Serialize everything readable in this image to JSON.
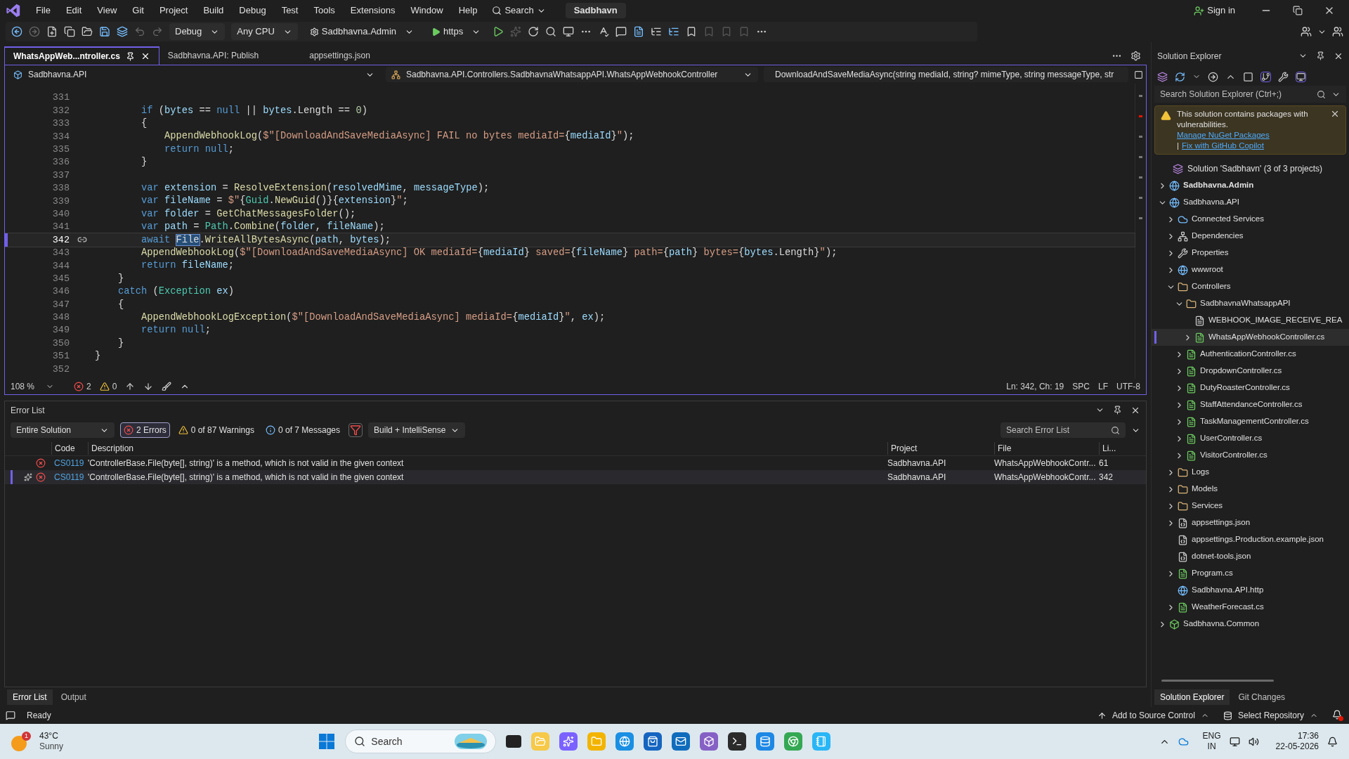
{
  "menu_bar": {
    "items": [
      "File",
      "Edit",
      "View",
      "Git",
      "Project",
      "Build",
      "Debug",
      "Test",
      "Tools",
      "Extensions",
      "Window",
      "Help"
    ],
    "search": "Search",
    "solution": "Sadbhavn",
    "sign_in": "Sign in"
  },
  "toolbar": {
    "dropdowns": [
      {
        "kind": "config",
        "label": "Debug"
      },
      {
        "kind": "platform",
        "label": "Any CPU"
      },
      {
        "kind": "startup",
        "label": "Sadbhavna.Admin"
      },
      {
        "kind": "run",
        "label": "https"
      }
    ]
  },
  "document_tabs": [
    {
      "label": "WhatsAppWeb...ntroller.cs",
      "selected": true
    },
    {
      "label": "Sadbhavna.API: Publish",
      "selected": false
    },
    {
      "label": "appsettings.json",
      "selected": false
    }
  ],
  "nav_bar": {
    "project": "Sadbhavna.API",
    "class": "Sadbhavna.API.Controllers.SadbhavnaWhatsappAPI.WhatsAppWebhookController",
    "member": "DownloadAndSaveMediaAsync(string mediaId, string? mimeType, string messageType, str"
  },
  "editor": {
    "lines": [
      {
        "number": "331",
        "current": false
      },
      {
        "number": "332",
        "current": false,
        "tokens": [
          {
            "kind": "kw",
            "text": "        if"
          },
          {
            "kind": "txt",
            "text": " ("
          },
          {
            "kind": "var",
            "text": "bytes"
          },
          {
            "kind": "txt",
            "text": " == "
          },
          {
            "kind": "kw",
            "text": "null"
          },
          {
            "kind": "txt",
            "text": " || "
          },
          {
            "kind": "var",
            "text": "bytes"
          },
          {
            "kind": "txt",
            "text": ".Length == "
          },
          {
            "kind": "num",
            "text": "0"
          },
          {
            "kind": "txt",
            "text": ")"
          }
        ]
      },
      {
        "number": "333",
        "current": false,
        "tokens": [
          {
            "kind": "txt",
            "text": "        {"
          }
        ]
      },
      {
        "number": "334",
        "current": false,
        "tokens": [
          {
            "kind": "fn",
            "text": "            AppendWebhookLog"
          },
          {
            "kind": "txt",
            "text": "("
          },
          {
            "kind": "str",
            "text": "$\"[DownloadAndSaveMediaAsync] FAIL no bytes mediaId="
          },
          {
            "kind": "txt",
            "text": "{"
          },
          {
            "kind": "var",
            "text": "mediaId"
          },
          {
            "kind": "txt",
            "text": "}"
          },
          {
            "kind": "str",
            "text": "\""
          },
          {
            "kind": "txt",
            "text": ");"
          }
        ]
      },
      {
        "number": "335",
        "current": false,
        "tokens": [
          {
            "kind": "kw",
            "text": "            return null"
          },
          {
            "kind": "txt",
            "text": ";"
          }
        ]
      },
      {
        "number": "336",
        "current": false,
        "tokens": [
          {
            "kind": "txt",
            "text": "        }"
          }
        ]
      },
      {
        "number": "337",
        "current": false
      },
      {
        "number": "338",
        "current": false,
        "tokens": [
          {
            "kind": "kw",
            "text": "        var "
          },
          {
            "kind": "var",
            "text": "extension"
          },
          {
            "kind": "txt",
            "text": " = "
          },
          {
            "kind": "fn",
            "text": "ResolveExtension"
          },
          {
            "kind": "txt",
            "text": "("
          },
          {
            "kind": "var",
            "text": "resolvedMime"
          },
          {
            "kind": "txt",
            "text": ", "
          },
          {
            "kind": "var",
            "text": "messageType"
          },
          {
            "kind": "txt",
            "text": ");"
          }
        ]
      },
      {
        "number": "339",
        "current": false,
        "tokens": [
          {
            "kind": "kw",
            "text": "        var "
          },
          {
            "kind": "var",
            "text": "fileName"
          },
          {
            "kind": "txt",
            "text": " = "
          },
          {
            "kind": "str",
            "text": "$\""
          },
          {
            "kind": "txt",
            "text": "{"
          },
          {
            "kind": "ty",
            "text": "Guid"
          },
          {
            "kind": "txt",
            "text": "."
          },
          {
            "kind": "fn",
            "text": "NewGuid"
          },
          {
            "kind": "txt",
            "text": "()}{"
          },
          {
            "kind": "var",
            "text": "extension"
          },
          {
            "kind": "txt",
            "text": "}"
          },
          {
            "kind": "str",
            "text": "\""
          },
          {
            "kind": "txt",
            "text": ";"
          }
        ]
      },
      {
        "number": "340",
        "current": false,
        "tokens": [
          {
            "kind": "kw",
            "text": "        var "
          },
          {
            "kind": "var",
            "text": "folder"
          },
          {
            "kind": "txt",
            "text": " = "
          },
          {
            "kind": "fn",
            "text": "GetChatMessagesFolder"
          },
          {
            "kind": "txt",
            "text": "();"
          }
        ]
      },
      {
        "number": "341",
        "current": false,
        "tokens": [
          {
            "kind": "kw",
            "text": "        var "
          },
          {
            "kind": "var",
            "text": "path"
          },
          {
            "kind": "txt",
            "text": " = "
          },
          {
            "kind": "ty",
            "text": "Path"
          },
          {
            "kind": "txt",
            "text": "."
          },
          {
            "kind": "fn",
            "text": "Combine"
          },
          {
            "kind": "txt",
            "text": "("
          },
          {
            "kind": "var",
            "text": "folder"
          },
          {
            "kind": "txt",
            "text": ", "
          },
          {
            "kind": "var",
            "text": "fileName"
          },
          {
            "kind": "txt",
            "text": ");"
          }
        ]
      },
      {
        "number": "342",
        "current": true,
        "tokens": [
          {
            "kind": "kw",
            "text": "        await "
          },
          {
            "kind": "hl",
            "text": "File"
          },
          {
            "kind": "txt",
            "text": "."
          },
          {
            "kind": "fn",
            "text": "WriteAllBytesAsync"
          },
          {
            "kind": "txt",
            "text": "("
          },
          {
            "kind": "var",
            "text": "path"
          },
          {
            "kind": "txt",
            "text": ", "
          },
          {
            "kind": "var",
            "text": "bytes"
          },
          {
            "kind": "txt",
            "text": ");"
          }
        ]
      },
      {
        "number": "343",
        "current": false,
        "tokens": [
          {
            "kind": "fn",
            "text": "        AppendWebhookLog"
          },
          {
            "kind": "txt",
            "text": "("
          },
          {
            "kind": "str",
            "text": "$\"[DownloadAndSaveMediaAsync] OK mediaId="
          },
          {
            "kind": "txt",
            "text": "{"
          },
          {
            "kind": "var",
            "text": "mediaId"
          },
          {
            "kind": "txt",
            "text": "}"
          },
          {
            "kind": "str",
            "text": " saved="
          },
          {
            "kind": "txt",
            "text": "{"
          },
          {
            "kind": "var",
            "text": "fileName"
          },
          {
            "kind": "txt",
            "text": "}"
          },
          {
            "kind": "str",
            "text": " path="
          },
          {
            "kind": "txt",
            "text": "{"
          },
          {
            "kind": "var",
            "text": "path"
          },
          {
            "kind": "txt",
            "text": "}"
          },
          {
            "kind": "str",
            "text": " bytes="
          },
          {
            "kind": "txt",
            "text": "{"
          },
          {
            "kind": "var",
            "text": "bytes"
          },
          {
            "kind": "txt",
            "text": ".Length}"
          },
          {
            "kind": "str",
            "text": "\""
          },
          {
            "kind": "txt",
            "text": ");"
          }
        ]
      },
      {
        "number": "344",
        "current": false,
        "tokens": [
          {
            "kind": "kw",
            "text": "        return "
          },
          {
            "kind": "var",
            "text": "fileName"
          },
          {
            "kind": "txt",
            "text": ";"
          }
        ]
      },
      {
        "number": "345",
        "current": false,
        "tokens": [
          {
            "kind": "txt",
            "text": "    }"
          }
        ]
      },
      {
        "number": "346",
        "current": false,
        "tokens": [
          {
            "kind": "kw",
            "text": "    catch"
          },
          {
            "kind": "txt",
            "text": " ("
          },
          {
            "kind": "ty",
            "text": "Exception"
          },
          {
            "kind": "var",
            "text": " ex"
          },
          {
            "kind": "txt",
            "text": ")"
          }
        ]
      },
      {
        "number": "347",
        "current": false,
        "tokens": [
          {
            "kind": "txt",
            "text": "    {"
          }
        ]
      },
      {
        "number": "348",
        "current": false,
        "tokens": [
          {
            "kind": "fn",
            "text": "        AppendWebhookLogException"
          },
          {
            "kind": "txt",
            "text": "("
          },
          {
            "kind": "str",
            "text": "$\"[DownloadAndSaveMediaAsync] mediaId="
          },
          {
            "kind": "txt",
            "text": "{"
          },
          {
            "kind": "var",
            "text": "mediaId"
          },
          {
            "kind": "txt",
            "text": "}"
          },
          {
            "kind": "str",
            "text": "\""
          },
          {
            "kind": "txt",
            "text": ", "
          },
          {
            "kind": "var",
            "text": "ex"
          },
          {
            "kind": "txt",
            "text": ");"
          }
        ]
      },
      {
        "number": "349",
        "current": false,
        "tokens": [
          {
            "kind": "kw",
            "text": "        return null"
          },
          {
            "kind": "txt",
            "text": ";"
          }
        ]
      },
      {
        "number": "350",
        "current": false,
        "tokens": [
          {
            "kind": "txt",
            "text": "    }"
          }
        ]
      },
      {
        "number": "351",
        "current": false,
        "tokens": [
          {
            "kind": "txt",
            "text": "}"
          }
        ]
      },
      {
        "number": "352",
        "current": false
      }
    ]
  },
  "editor_status": {
    "zoom": "108 %",
    "errors": "2",
    "warnings": "0",
    "position": "Ln: 342, Ch: 19",
    "whitespace": "SPC",
    "line_ending": "LF",
    "encoding": "UTF-8"
  },
  "error_list": {
    "title": "Error List",
    "scope": "Entire Solution",
    "filters": [
      {
        "kind": "errors",
        "label": "2 Errors",
        "selected": true
      },
      {
        "kind": "warnings",
        "label": "0 of 87 Warnings",
        "selected": false
      },
      {
        "kind": "messages",
        "label": "0 of 7 Messages",
        "selected": false
      }
    ],
    "source": "Build + IntelliSense",
    "search_placeholder": "Search Error List",
    "columns": [
      "Code",
      "Description",
      "Project",
      "File",
      "Li..."
    ],
    "rows": [
      {
        "code": "CS0119",
        "description": "'ControllerBase.File(byte[], string)' is a method, which is not valid in the given context",
        "project": "Sadbhavna.API",
        "file": "WhatsAppWebhookContr...",
        "line": "61",
        "selected": false
      },
      {
        "code": "CS0119",
        "description": "'ControllerBase.File(byte[], string)' is a method, which is not valid in the given context",
        "project": "Sadbhavna.API",
        "file": "WhatsAppWebhookContr...",
        "line": "342",
        "selected": true
      }
    ]
  },
  "bottom_tabs_left": [
    {
      "label": "Error List",
      "selected": true
    },
    {
      "label": "Output",
      "selected": false
    }
  ],
  "solution_explorer": {
    "title": "Solution Explorer",
    "search_placeholder": "Search Solution Explorer (Ctrl+;)",
    "banner": {
      "text": "This solution contains packages with vulnerabilities.",
      "links": [
        "Manage NuGet Packages",
        "Fix with GitHub Copilot"
      ],
      "separator": "|"
    },
    "tree": {
      "label": "Solution 'Sadbhavn' (3 of 3 projects)",
      "kind": "solution",
      "selected": false,
      "children": [
        {
          "label": "Sadbhavna.Admin",
          "kind": "project",
          "startup": true,
          "expanded": false,
          "selected": false
        },
        {
          "label": "Sadbhavna.API",
          "kind": "project",
          "startup": false,
          "expanded": true,
          "selected": false,
          "children": [
            {
              "label": "Connected Services",
              "kind": "services",
              "expanded": false,
              "selected": false
            },
            {
              "label": "Dependencies",
              "kind": "deps",
              "expanded": false,
              "selected": false
            },
            {
              "label": "Properties",
              "kind": "props",
              "expanded": false,
              "selected": false
            },
            {
              "label": "wwwroot",
              "kind": "web",
              "expanded": false,
              "selected": false
            },
            {
              "label": "Controllers",
              "kind": "folder",
              "expanded": true,
              "selected": false,
              "children": [
                {
                  "label": "SadbhavnaWhatsappAPI",
                  "kind": "folder",
                  "expanded": true,
                  "selected": false,
                  "children": [
                    {
                      "label": "WEBHOOK_IMAGE_RECEIVE_REA",
                      "kind": "md",
                      "selected": false
                    },
                    {
                      "label": "WhatsAppWebhookController.cs",
                      "kind": "cs",
                      "expanded": false,
                      "selected": true
                    }
                  ]
                },
                {
                  "label": "AuthenticationController.cs",
                  "kind": "cs",
                  "expanded": false,
                  "selected": false
                },
                {
                  "label": "DropdownController.cs",
                  "kind": "cs",
                  "expanded": false,
                  "selected": false
                },
                {
                  "label": "DutyRoasterController.cs",
                  "kind": "cs",
                  "expanded": false,
                  "selected": false
                },
                {
                  "label": "StaffAttendanceController.cs",
                  "kind": "cs",
                  "expanded": false,
                  "selected": false
                },
                {
                  "label": "TaskManagementController.cs",
                  "kind": "cs",
                  "expanded": false,
                  "selected": false
                },
                {
                  "label": "UserController.cs",
                  "kind": "cs",
                  "expanded": false,
                  "selected": false
                },
                {
                  "label": "VisitorController.cs",
                  "kind": "cs",
                  "expanded": false,
                  "selected": false
                }
              ]
            },
            {
              "label": "Logs",
              "kind": "folder",
              "expanded": false,
              "selected": false
            },
            {
              "label": "Models",
              "kind": "folder",
              "expanded": false,
              "selected": false
            },
            {
              "label": "Services",
              "kind": "folder",
              "expanded": false,
              "selected": false
            },
            {
              "label": "appsettings.json",
              "kind": "json",
              "expanded": false,
              "selected": false
            },
            {
              "label": "appsettings.Production.example.json",
              "kind": "json",
              "selected": false
            },
            {
              "label": "dotnet-tools.json",
              "kind": "json",
              "selected": false
            },
            {
              "label": "Program.cs",
              "kind": "cs",
              "expanded": false,
              "selected": false
            },
            {
              "label": "Sadbhavna.API.http",
              "kind": "http",
              "selected": false
            },
            {
              "label": "WeatherForecast.cs",
              "kind": "cs",
              "expanded": false,
              "selected": false
            }
          ]
        },
        {
          "label": "Sadbhavna.Common",
          "kind": "library",
          "startup": false,
          "expanded": false,
          "selected": false
        }
      ]
    }
  },
  "bottom_tabs_right": [
    {
      "label": "Solution Explorer",
      "selected": true
    },
    {
      "label": "Git Changes",
      "selected": false
    }
  ],
  "status_bar": {
    "status": "Ready",
    "source_control": "Add to Source Control",
    "repository": "Select Repository"
  },
  "taskbar": {
    "temperature": "43°C",
    "condition": "Sunny",
    "weather_badge": "1",
    "search_placeholder": "Search",
    "language": "ENG",
    "region": "IN",
    "time": "17:36",
    "date": "22-05-2026"
  }
}
